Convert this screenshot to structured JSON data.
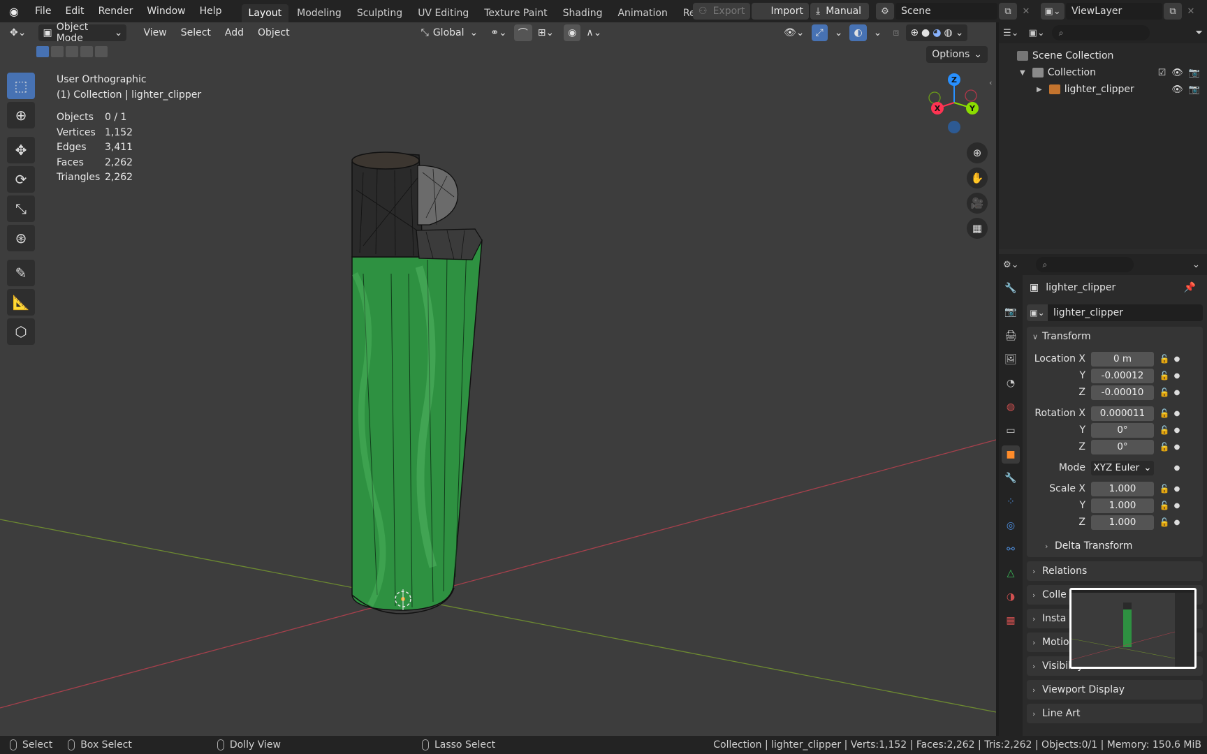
{
  "topbar": {
    "menus": [
      "File",
      "Edit",
      "Render",
      "Window",
      "Help"
    ],
    "workspaces": [
      "Layout",
      "Modeling",
      "Sculpting",
      "UV Editing",
      "Texture Paint",
      "Shading",
      "Animation",
      "Rendering"
    ],
    "active_workspace": "Layout",
    "export_label": "Export",
    "import_label": "Import",
    "manual_label": "Manual",
    "scene": "Scene",
    "view_layer": "ViewLayer"
  },
  "viewport": {
    "mode": "Object Mode",
    "menus": [
      "View",
      "Select",
      "Add",
      "Object"
    ],
    "orientation": "Global",
    "options_label": "Options",
    "view_name": "User Orthographic",
    "collection_line": "(1) Collection | lighter_clipper",
    "stats": [
      {
        "k": "Objects",
        "v": "0 / 1"
      },
      {
        "k": "Vertices",
        "v": "1,152"
      },
      {
        "k": "Edges",
        "v": "3,411"
      },
      {
        "k": "Faces",
        "v": "2,262"
      },
      {
        "k": "Triangles",
        "v": "2,262"
      }
    ],
    "gizmo": {
      "x": "X",
      "y": "Y",
      "z": "Z"
    }
  },
  "outliner": {
    "scene_collection": "Scene Collection",
    "collection": "Collection",
    "object": "lighter_clipper"
  },
  "properties": {
    "object_name": "lighter_clipper",
    "data_name": "lighter_clipper",
    "transform_label": "Transform",
    "location": {
      "label": "Location X",
      "x": "0 m",
      "y": "-0.00012",
      "z": "-0.00010"
    },
    "rotation": {
      "label": "Rotation X",
      "x": "0.000011",
      "y": "0°",
      "z": "0°"
    },
    "mode": {
      "label": "Mode",
      "value": "XYZ Euler"
    },
    "scale": {
      "label": "Scale X",
      "x": "1.000",
      "y": "1.000",
      "z": "1.000"
    },
    "axis_y": "Y",
    "axis_z": "Z",
    "delta_transform": "Delta Transform",
    "collapsed_panels": [
      "Relations",
      "Colle",
      "Insta",
      "Motio",
      "Visibility",
      "Viewport Display",
      "Line Art"
    ]
  },
  "statusbar": {
    "select": "Select",
    "box_select": "Box Select",
    "dolly": "Dolly View",
    "lasso": "Lasso Select",
    "info": "Collection | lighter_clipper | Verts:1,152 | Faces:2,262 | Tris:2,262 | Objects:0/1 | Memory: 150.6 MiB"
  },
  "colors": {
    "accent": "#4772b3",
    "x_axis": "#ff3352",
    "y_axis": "#8bdc00",
    "z_axis": "#2890ff",
    "body": "#2f9a45"
  }
}
